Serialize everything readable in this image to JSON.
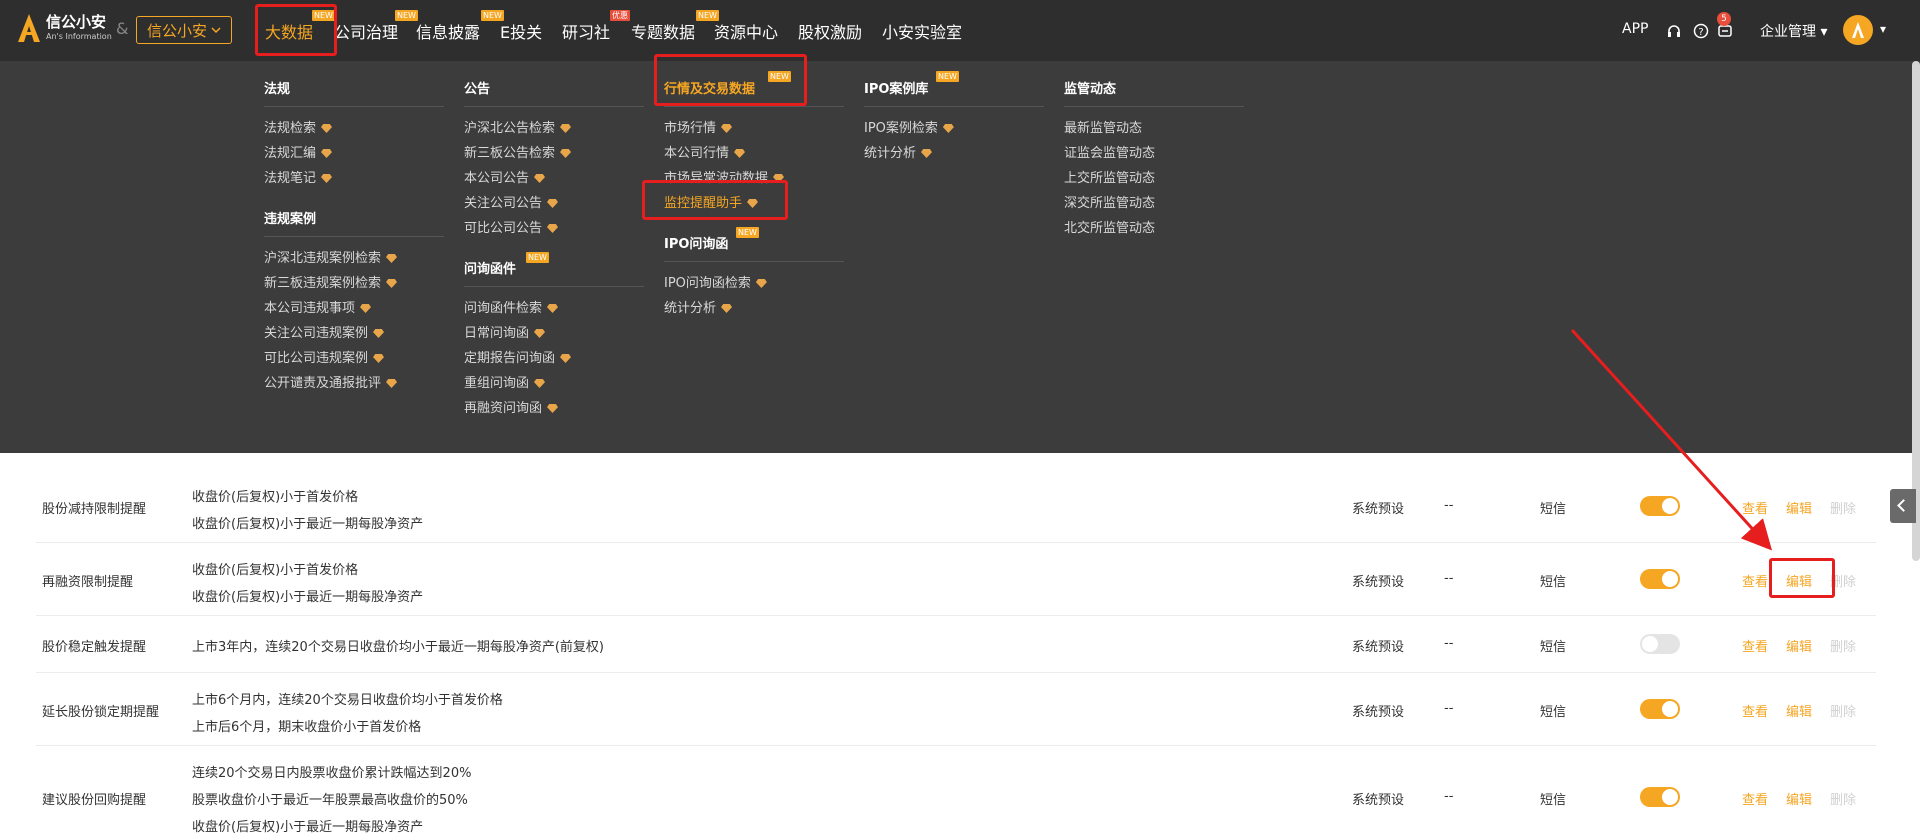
{
  "logo": {
    "title": "信公小安",
    "subtitle": "An's Information"
  },
  "amp": "&",
  "brand": {
    "label": "信公小安"
  },
  "nav": {
    "items": [
      {
        "label": "大数据",
        "badge": "NEW"
      },
      {
        "label": "公司治理",
        "badge": "NEW"
      },
      {
        "label": "信息披露",
        "badge": "NEW"
      },
      {
        "label": "E投关",
        "badge": ""
      },
      {
        "label": "研习社",
        "badge": "优惠"
      },
      {
        "label": "专题数据",
        "badge": "NEW"
      },
      {
        "label": "资源中心",
        "badge": ""
      },
      {
        "label": "股权激励",
        "badge": ""
      },
      {
        "label": "小安实验室",
        "badge": ""
      }
    ],
    "app": "APP",
    "notif_count": "5",
    "enterprise": "企业管理"
  },
  "mega": {
    "col1": {
      "title": "法规",
      "links": [
        "法规检索",
        "法规汇编",
        "法规笔记"
      ],
      "title2": "违规案例",
      "links2": [
        "沪深北违规案例检索",
        "新三板违规案例检索",
        "本公司违规事项",
        "关注公司违规案例",
        "可比公司违规案例",
        "公开谴责及通报批评"
      ]
    },
    "col2": {
      "title": "公告",
      "links": [
        "沪深北公告检索",
        "新三板公告检索",
        "本公司公告",
        "关注公司公告",
        "可比公司公告"
      ],
      "title2": "问询函件",
      "badge2": "NEW",
      "links2": [
        "问询函件检索",
        "日常问询函",
        "定期报告问询函",
        "重组问询函",
        "再融资问询函"
      ]
    },
    "col3": {
      "title": "行情及交易数据",
      "badge": "NEW",
      "links": [
        "市场行情",
        "本公司行情",
        "市场异常波动数据",
        "监控提醒助手"
      ],
      "title2": "IPO问询函",
      "badge2": "NEW",
      "links2": [
        "IPO问询函检索",
        "统计分析"
      ]
    },
    "col4": {
      "title": "IPO案例库",
      "badge": "NEW",
      "links": [
        "IPO案例检索",
        "统计分析"
      ]
    },
    "col5": {
      "title": "监管动态",
      "links": [
        "最新监管动态",
        "证监会监管动态",
        "上交所监管动态",
        "深交所监管动态",
        "北交所监管动态"
      ]
    }
  },
  "table": {
    "ops": {
      "view": "查看",
      "edit": "编辑",
      "delete": "删除"
    },
    "rows": [
      {
        "name": "股份减持限制提醒",
        "conds": [
          "收盘价(后复权)小于首发价格",
          "收盘价(后复权)小于最近一期每股净资产"
        ],
        "source": "系统预设",
        "dash": "--",
        "channel": "短信",
        "enabled": true
      },
      {
        "name": "再融资限制提醒",
        "conds": [
          "收盘价(后复权)小于首发价格",
          "收盘价(后复权)小于最近一期每股净资产"
        ],
        "source": "系统预设",
        "dash": "--",
        "channel": "短信",
        "enabled": true
      },
      {
        "name": "股价稳定触发提醒",
        "conds": [
          "上市3年内，连续20个交易日收盘价均小于最近一期每股净资产(前复权)"
        ],
        "source": "系统预设",
        "dash": "--",
        "channel": "短信",
        "enabled": false
      },
      {
        "name": "延长股份锁定期提醒",
        "conds": [
          "上市6个月内，连续20个交易日收盘价均小于首发价格",
          "上市后6个月，期末收盘价小于首发价格"
        ],
        "source": "系统预设",
        "dash": "--",
        "channel": "短信",
        "enabled": true
      },
      {
        "name": "建议股份回购提醒",
        "conds": [
          "连续20个交易日内股票收盘价累计跌幅达到20%",
          "股票收盘价小于最近一年股票最高收盘价的50%",
          "收盘价(后复权)小于最近一期每股净资产"
        ],
        "source": "系统预设",
        "dash": "--",
        "channel": "短信",
        "enabled": true
      }
    ]
  },
  "colors": {
    "accent": "#f5a623",
    "nav_bg": "#2e2e2e",
    "menu_bg": "#3c3c3c",
    "annotation": "#e61e1e"
  }
}
